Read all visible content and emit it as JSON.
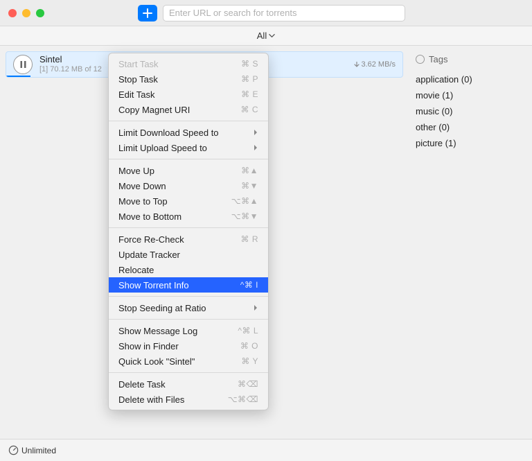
{
  "search": {
    "placeholder": "Enter URL or search for torrents"
  },
  "filter": {
    "label": "All"
  },
  "torrent": {
    "name": "Sintel",
    "priority": "[1]",
    "progress_text": "70.12 MB of 12",
    "speed": "3.62 MB/s"
  },
  "sidebar": {
    "tags_label": "Tags",
    "tags": [
      {
        "label": "application (0)"
      },
      {
        "label": "movie (1)"
      },
      {
        "label": "music (0)"
      },
      {
        "label": "other (0)"
      },
      {
        "label": "picture (1)"
      }
    ]
  },
  "statusbar": {
    "label": "Unlimited"
  },
  "menu": {
    "start_task": {
      "label": "Start Task",
      "shortcut": "⌘ S"
    },
    "stop_task": {
      "label": "Stop Task",
      "shortcut": "⌘ P"
    },
    "edit_task": {
      "label": "Edit Task",
      "shortcut": "⌘ E"
    },
    "copy_magnet": {
      "label": "Copy Magnet URI",
      "shortcut": "⌘ C"
    },
    "limit_down": {
      "label": "Limit Download Speed to"
    },
    "limit_up": {
      "label": "Limit Upload Speed to"
    },
    "move_up": {
      "label": "Move Up",
      "shortcut": "⌘▲"
    },
    "move_down": {
      "label": "Move Down",
      "shortcut": "⌘▼"
    },
    "move_top": {
      "label": "Move to Top",
      "shortcut": "⌥⌘▲"
    },
    "move_bottom": {
      "label": "Move to Bottom",
      "shortcut": "⌥⌘▼"
    },
    "force_recheck": {
      "label": "Force Re-Check",
      "shortcut": "⌘ R"
    },
    "update_tracker": {
      "label": "Update Tracker"
    },
    "relocate": {
      "label": "Relocate"
    },
    "show_info": {
      "label": "Show Torrent Info",
      "shortcut": "^⌘ I"
    },
    "stop_seeding": {
      "label": "Stop Seeding at Ratio"
    },
    "show_log": {
      "label": "Show Message Log",
      "shortcut": "^⌘ L"
    },
    "show_finder": {
      "label": "Show in Finder",
      "shortcut": "⌘ O"
    },
    "quick_look": {
      "label": "Quick Look \"Sintel\"",
      "shortcut": "⌘ Y"
    },
    "delete_task": {
      "label": "Delete Task",
      "shortcut": "⌘⌫"
    },
    "delete_files": {
      "label": "Delete with Files",
      "shortcut": "⌥⌘⌫"
    }
  }
}
